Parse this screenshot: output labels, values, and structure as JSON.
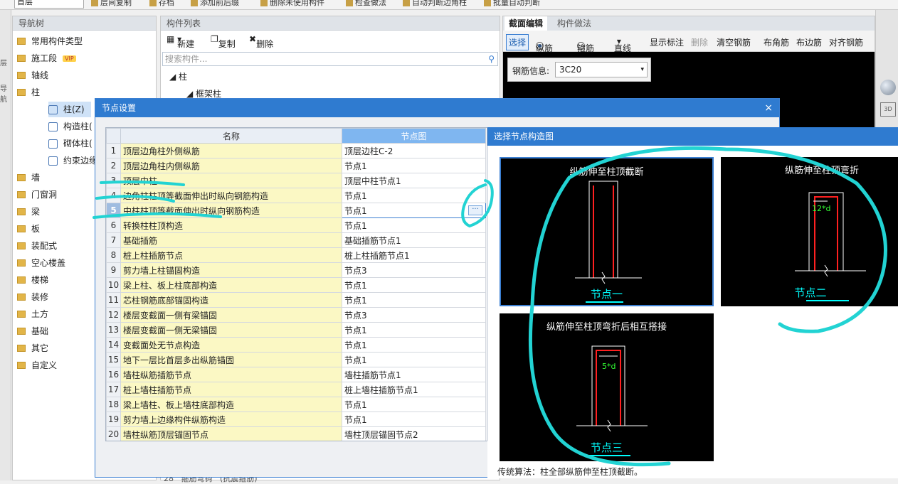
{
  "toolbar": {
    "floor_value": "首层",
    "items": [
      "层间复制",
      "存档",
      "添加前后缀",
      "删除未使用构件",
      "检查做法",
      "自动判断边角柱",
      "批量自动判断"
    ]
  },
  "left_strip": {
    "label1": "层",
    "label2": "导航"
  },
  "nav": {
    "title": "导航树",
    "items": [
      {
        "label": "常用构件类型"
      },
      {
        "label": "施工段",
        "badge": "VIP"
      },
      {
        "label": "轴线"
      },
      {
        "label": "柱"
      },
      {
        "label": "墙"
      },
      {
        "label": "门窗洞"
      },
      {
        "label": "梁"
      },
      {
        "label": "板"
      },
      {
        "label": "装配式"
      },
      {
        "label": "空心楼盖"
      },
      {
        "label": "楼梯"
      },
      {
        "label": "装修"
      },
      {
        "label": "土方"
      },
      {
        "label": "基础"
      },
      {
        "label": "其它"
      },
      {
        "label": "自定义"
      }
    ],
    "subitems": [
      "柱(Z)",
      "构造柱(",
      "砌体柱(",
      "约束边缘"
    ]
  },
  "component_list": {
    "title": "构件列表",
    "new_label": "新建",
    "copy_label": "复制",
    "delete_label": "删除",
    "search_placeholder": "搜索构件...",
    "tree_root": "柱",
    "tree_child": "框架柱",
    "bottom_row_num": "28",
    "bottom_row_text": "箍筋弯钩",
    "bottom_row_val": "(抗震箍筋)"
  },
  "section": {
    "tab1": "截面编辑",
    "tab2": "构件做法",
    "select": "选择",
    "radio1": "纵筋",
    "radio2": "箍筋",
    "line": "直线",
    "show_label": "显示标注",
    "delete": "删除",
    "clear": "清空钢筋",
    "corner": "布角筋",
    "edge": "布边筋",
    "sym": "对齐钢筋",
    "rebar_label": "钢筋信息:",
    "rebar_value": "3C20"
  },
  "dialog": {
    "title": "节点设置",
    "close": "×",
    "col_name": "名称",
    "col_node": "节点图",
    "rows": [
      {
        "n": "1",
        "name": "顶层边角柱外侧纵筋",
        "node": "顶层边柱C-2"
      },
      {
        "n": "2",
        "name": "顶层边角柱内侧纵筋",
        "node": "节点1"
      },
      {
        "n": "3",
        "name": "顶层中柱",
        "node": "顶层中柱节点1"
      },
      {
        "n": "4",
        "name": "边角柱柱顶等截面伸出时纵向钢筋构造",
        "node": "节点1"
      },
      {
        "n": "5",
        "name": "中柱柱顶等截面伸出时纵向钢筋构造",
        "node": "节点1"
      },
      {
        "n": "6",
        "name": "转换柱柱顶构造",
        "node": "节点1"
      },
      {
        "n": "7",
        "name": "基础插筋",
        "node": "基础插筋节点1"
      },
      {
        "n": "8",
        "name": "桩上柱插筋节点",
        "node": "桩上柱插筋节点1"
      },
      {
        "n": "9",
        "name": "剪力墙上柱锚固构造",
        "node": "节点3"
      },
      {
        "n": "10",
        "name": "梁上柱、板上柱底部构造",
        "node": "节点1"
      },
      {
        "n": "11",
        "name": "芯柱钢筋底部锚固构造",
        "node": "节点1"
      },
      {
        "n": "12",
        "name": "楼层变截面一侧有梁锚固",
        "node": "节点3"
      },
      {
        "n": "13",
        "name": "楼层变截面一侧无梁锚固",
        "node": "节点1"
      },
      {
        "n": "14",
        "name": "变截面处无节点构造",
        "node": "节点1"
      },
      {
        "n": "15",
        "name": "地下一层比首层多出纵筋锚固",
        "node": "节点1"
      },
      {
        "n": "16",
        "name": "墙柱纵筋插筋节点",
        "node": "墙柱插筋节点1"
      },
      {
        "n": "17",
        "name": "桩上墙柱插筋节点",
        "node": "桩上墙柱插筋节点1"
      },
      {
        "n": "18",
        "name": "梁上墙柱、板上墙柱底部构造",
        "node": "节点1"
      },
      {
        "n": "19",
        "name": "剪力墙上边缘构件纵筋构造",
        "node": "节点1"
      },
      {
        "n": "20",
        "name": "墙柱纵筋顶层锚固节点",
        "node": "墙柱顶层锚固节点2"
      }
    ],
    "dots": "···"
  },
  "picker": {
    "title": "选择节点构造图",
    "nodes": [
      {
        "title": "纵筋伸至柱顶截断",
        "label": "节点一"
      },
      {
        "title": "纵筋伸至柱顶弯折",
        "label": "节点二",
        "dim": "12*d"
      },
      {
        "title": "纵筋伸至柱顶弯折后相互搭接",
        "label": "节点三",
        "dim": "5*d"
      }
    ],
    "description": "传统算法：柱全部纵筋伸至柱顶截断。"
  },
  "colors": {
    "accent": "#2f7bd0",
    "annotation": "#22d3d3",
    "rebar": "#ff2020",
    "name_cell": "#fbf8c4"
  }
}
